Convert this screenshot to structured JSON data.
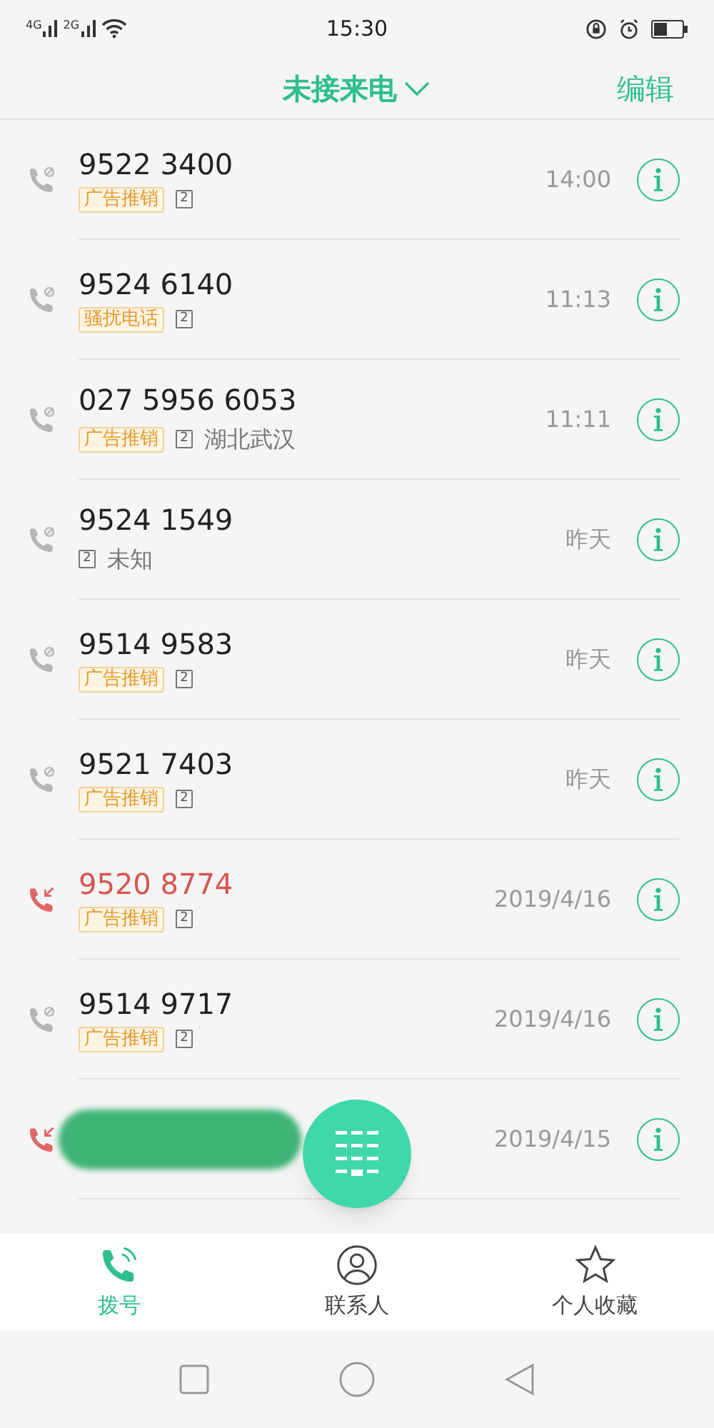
{
  "status_bar": {
    "networks": [
      "4G",
      "2G"
    ],
    "time": "15:30"
  },
  "header": {
    "title": "未接来电",
    "action": "编辑"
  },
  "calls": [
    {
      "kind": "blocked",
      "number": "9522 3400",
      "tag": "广告推销",
      "sim": "2",
      "time": "14:00"
    },
    {
      "kind": "blocked",
      "number": "9524 6140",
      "tag": "骚扰电话",
      "sim": "2",
      "time": "11:13"
    },
    {
      "kind": "blocked",
      "number": "027 5956 6053",
      "tag": "广告推销",
      "sim": "2",
      "location": "湖北武汉",
      "time": "11:11"
    },
    {
      "kind": "blocked",
      "number": "9524 1549",
      "sim": "2",
      "location": "未知",
      "time": "昨天"
    },
    {
      "kind": "blocked",
      "number": "9514 9583",
      "tag": "广告推销",
      "sim": "2",
      "time": "昨天"
    },
    {
      "kind": "blocked",
      "number": "9521 7403",
      "tag": "广告推销",
      "sim": "2",
      "time": "昨天"
    },
    {
      "kind": "missed",
      "number": "9520 8774",
      "tag": "广告推销",
      "sim": "2",
      "time": "2019/4/16"
    },
    {
      "kind": "blocked",
      "number": "9514 9717",
      "tag": "广告推销",
      "sim": "2",
      "time": "2019/4/16"
    },
    {
      "kind": "missed",
      "redacted": true,
      "time": "2019/4/15"
    }
  ],
  "tabs": [
    {
      "kind": "dial",
      "label": "拨号",
      "selected": true
    },
    {
      "kind": "contacts",
      "label": "联系人",
      "selected": false
    },
    {
      "kind": "favorites",
      "label": "个人收藏",
      "selected": false
    }
  ]
}
